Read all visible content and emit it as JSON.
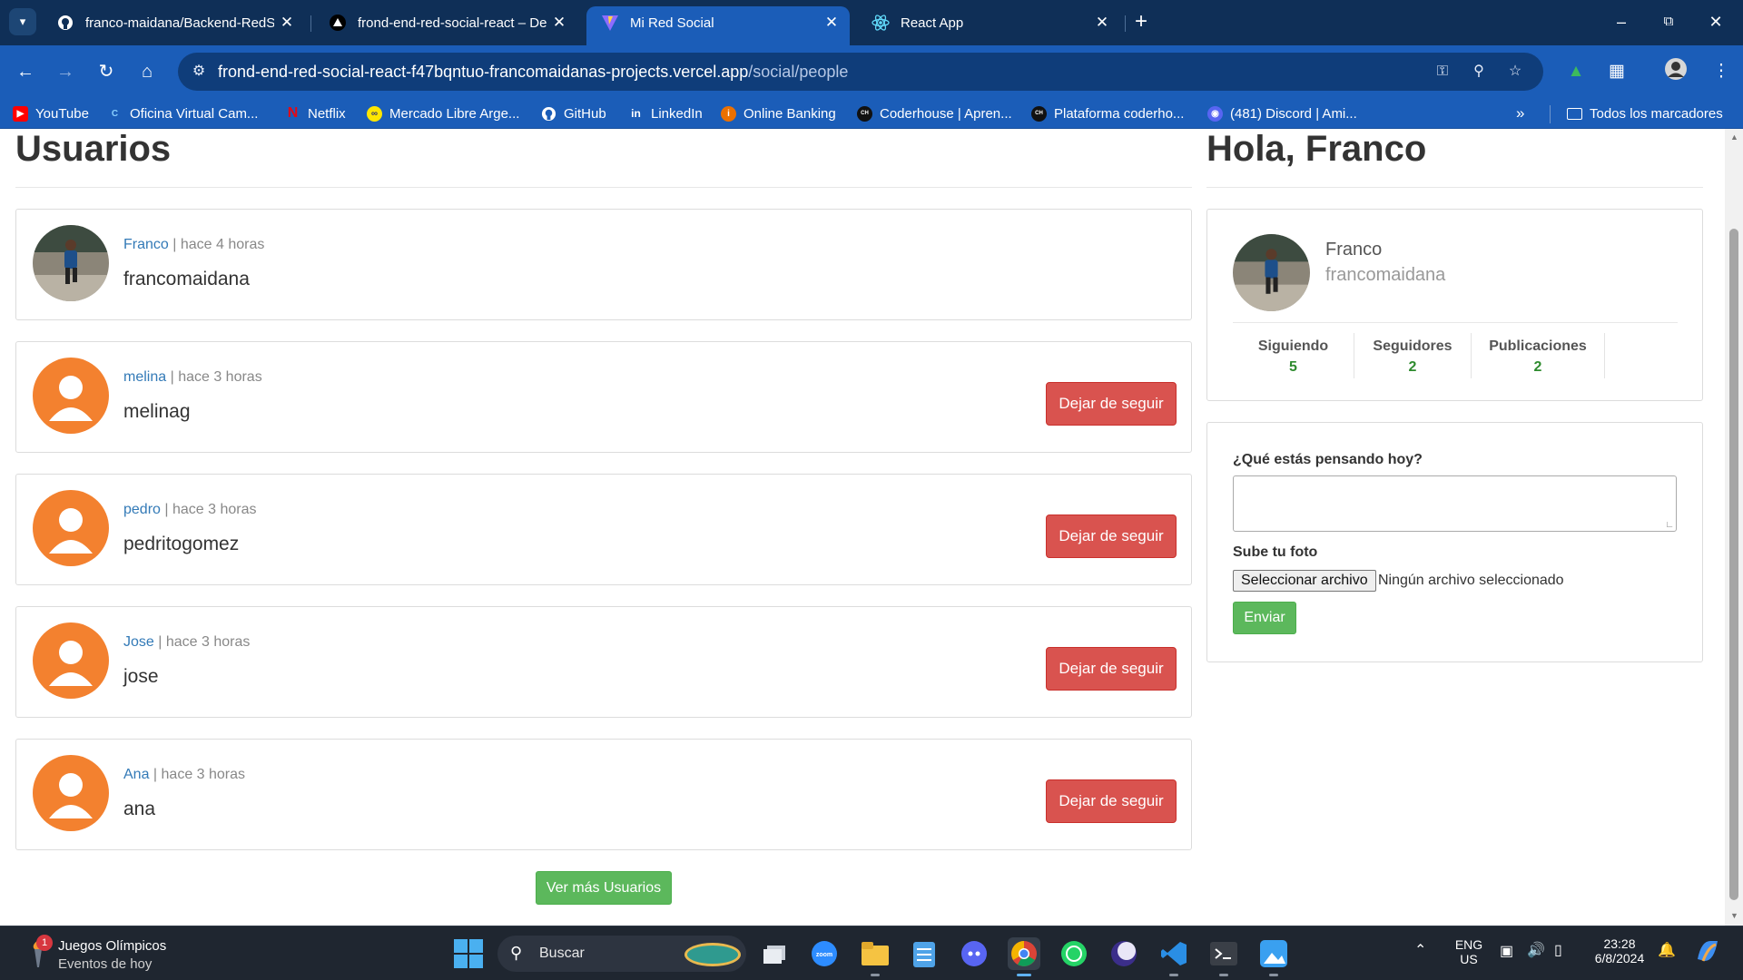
{
  "browser": {
    "tabs": [
      {
        "title": "franco-maidana/Backend-RedSocial",
        "icon": "github-icon",
        "active": false
      },
      {
        "title": "frond-end-red-social-react – Deployment",
        "icon": "vercel-icon",
        "active": false
      },
      {
        "title": "Mi Red Social",
        "icon": "vite-icon",
        "active": true
      },
      {
        "title": "React App",
        "icon": "react-icon",
        "active": false
      }
    ],
    "url_host": "frond-end-red-social-react-f47bqntuo-francomaidanas-projects.vercel.app",
    "url_path": "/social/people",
    "bookmarks": [
      {
        "label": "YouTube",
        "icon": "youtube-icon",
        "color": "#ff0000"
      },
      {
        "label": "Oficina Virtual Cam...",
        "icon": "oficina-icon",
        "color": "#1b5db8"
      },
      {
        "label": "Netflix",
        "icon": "netflix-icon",
        "color": "#e50914"
      },
      {
        "label": "Mercado Libre Arge...",
        "icon": "mercadolibre-icon",
        "color": "#ffe600"
      },
      {
        "label": "GitHub",
        "icon": "github-icon",
        "color": "#1b5db8"
      },
      {
        "label": "LinkedIn",
        "icon": "linkedin-icon",
        "color": "#1b5db8"
      },
      {
        "label": "Online Banking",
        "icon": "bank-icon",
        "color": "#ec7000"
      },
      {
        "label": "Coderhouse | Apren...",
        "icon": "coderhouse-icon",
        "color": "#111111"
      },
      {
        "label": "Plataforma coderho...",
        "icon": "coderhouse-icon",
        "color": "#111111"
      },
      {
        "label": "(481) Discord | Ami...",
        "icon": "discord-icon",
        "color": "#5865f2"
      }
    ],
    "all_bookmarks": "Todos los marcadores"
  },
  "users_section": {
    "title": "Usuarios",
    "users": [
      {
        "name": "Franco",
        "time": "hace 4 horas",
        "nick": "francomaidana",
        "avatar": "photo",
        "button": ""
      },
      {
        "name": "melina",
        "time": "hace 3 horas",
        "nick": "melinag",
        "avatar": "default",
        "button": "Dejar de seguir"
      },
      {
        "name": "pedro",
        "time": "hace 3 horas",
        "nick": "pedritogomez",
        "avatar": "default",
        "button": "Dejar de seguir"
      },
      {
        "name": "Jose",
        "time": "hace 3 horas",
        "nick": "jose",
        "avatar": "default",
        "button": "Dejar de seguir"
      },
      {
        "name": "Ana",
        "time": "hace 3 horas",
        "nick": "ana",
        "avatar": "default",
        "button": "Dejar de seguir"
      }
    ],
    "load_more": "Ver más Usuarios"
  },
  "sidebar": {
    "greeting": "Hola, Franco",
    "profile": {
      "name": "Franco",
      "nick": "francomaidana"
    },
    "stats": [
      {
        "label": "Siguiendo",
        "value": "5"
      },
      {
        "label": "Seguidores",
        "value": "2"
      },
      {
        "label": "Publicaciones",
        "value": "2"
      }
    ],
    "form": {
      "prompt": "¿Qué estás pensando hoy?",
      "photo_label": "Sube tu foto",
      "file_button": "Seleccionar archivo",
      "file_status": "Ningún archivo seleccionado",
      "submit": "Enviar"
    }
  },
  "taskbar": {
    "widget_badge": "1",
    "widget_title": "Juegos Olímpicos",
    "widget_subtitle": "Eventos de hoy",
    "search_placeholder": "Buscar",
    "language": "ENG",
    "region": "US",
    "time": "23:28",
    "date": "6/8/2024"
  },
  "colors": {
    "link": "#337ab7",
    "danger": "#d9534f",
    "success": "#5cb85c",
    "avatar_default": "#f3812f",
    "chrome_active": "#1b5db8"
  }
}
